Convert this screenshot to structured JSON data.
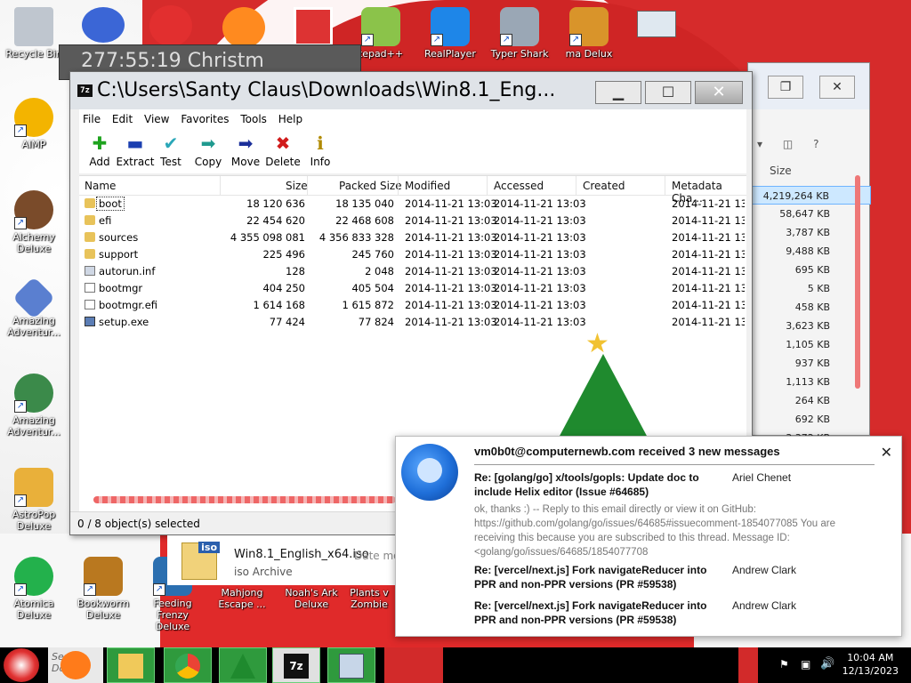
{
  "desktop": {
    "icons_left": [
      {
        "label": "Recycle Bin"
      },
      {
        "label": "AIMP"
      },
      {
        "label": "Alchemy Deluxe"
      },
      {
        "label": "Amazing Adventur..."
      },
      {
        "label": "Amazing Adventur..."
      },
      {
        "label": "AstroPop Deluxe"
      },
      {
        "label": "Atomica Deluxe"
      }
    ],
    "icons_top": [
      {
        "label": "tepad++"
      },
      {
        "label": "RealPlayer"
      },
      {
        "label": "Typer Shark"
      },
      {
        "label": "ma Delux"
      }
    ],
    "icons_bottom": [
      {
        "label": "Bookworm Deluxe"
      },
      {
        "label": "Feeding Frenzy Deluxe"
      },
      {
        "label": "Mahjong Escape ..."
      },
      {
        "label": "Noah's Ark Deluxe"
      },
      {
        "label": "Plants v Zombie"
      }
    ]
  },
  "gadget": {
    "text": "277:55:19    Christm"
  },
  "bg_window": {
    "size_header": "Size",
    "sizes": [
      "4,219,264 KB",
      "58,647 KB",
      "3,787 KB",
      "9,488 KB",
      "695 KB",
      "5 KB",
      "458 KB",
      "3,623 KB",
      "1,105 KB",
      "937 KB",
      "1,113 KB",
      "264 KB",
      "692 KB",
      "3,372 KB"
    ]
  },
  "zip": {
    "app_icon": "7z",
    "title": "C:\\Users\\Santy Claus\\Downloads\\Win8.1_Eng...",
    "menu": [
      "File",
      "Edit",
      "View",
      "Favorites",
      "Tools",
      "Help"
    ],
    "toolbar": [
      {
        "label": "Add",
        "icon": "plus-icon",
        "glyph": "✚",
        "color": "#1ea31e"
      },
      {
        "label": "Extract",
        "icon": "minus-icon",
        "glyph": "▬",
        "color": "#1b3fb0"
      },
      {
        "label": "Test",
        "icon": "check-icon",
        "glyph": "✔",
        "color": "#2aa7b8"
      },
      {
        "label": "Copy",
        "icon": "copy-arrow-icon",
        "glyph": "➡",
        "color": "#1f9a8f"
      },
      {
        "label": "Move",
        "icon": "move-arrow-icon",
        "glyph": "➡",
        "color": "#1b2f9a"
      },
      {
        "label": "Delete",
        "icon": "delete-x-icon",
        "glyph": "✖",
        "color": "#d11c1c"
      },
      {
        "label": "Info",
        "icon": "info-icon",
        "glyph": "ℹ",
        "color": "#b08a00"
      }
    ],
    "columns": [
      "Name",
      "Size",
      "Packed Size",
      "Modified",
      "Accessed",
      "Created",
      "Metadata Cha..."
    ],
    "rows": [
      {
        "name": "boot",
        "size": "18 120 636",
        "packed": "18 135 040",
        "modified": "2014-11-21 13:03",
        "accessed": "2014-11-21 13:03",
        "created": "",
        "meta": "2014-11-21 13:0",
        "kind": "folder"
      },
      {
        "name": "efi",
        "size": "22 454 620",
        "packed": "22 468 608",
        "modified": "2014-11-21 13:03",
        "accessed": "2014-11-21 13:03",
        "created": "",
        "meta": "2014-11-21 13:0",
        "kind": "folder"
      },
      {
        "name": "sources",
        "size": "4 355 098 081",
        "packed": "4 356 833 328",
        "modified": "2014-11-21 13:03",
        "accessed": "2014-11-21 13:03",
        "created": "",
        "meta": "2014-11-21 13:0",
        "kind": "folder"
      },
      {
        "name": "support",
        "size": "225 496",
        "packed": "245 760",
        "modified": "2014-11-21 13:03",
        "accessed": "2014-11-21 13:03",
        "created": "",
        "meta": "2014-11-21 13:0",
        "kind": "folder"
      },
      {
        "name": "autorun.inf",
        "size": "128",
        "packed": "2 048",
        "modified": "2014-11-21 13:03",
        "accessed": "2014-11-21 13:03",
        "created": "",
        "meta": "2014-11-21 13:0",
        "kind": "inf"
      },
      {
        "name": "bootmgr",
        "size": "404 250",
        "packed": "405 504",
        "modified": "2014-11-21 13:03",
        "accessed": "2014-11-21 13:03",
        "created": "",
        "meta": "2014-11-21 13:0",
        "kind": "file"
      },
      {
        "name": "bootmgr.efi",
        "size": "1 614 168",
        "packed": "1 615 872",
        "modified": "2014-11-21 13:03",
        "accessed": "2014-11-21 13:03",
        "created": "",
        "meta": "2014-11-21 13:0",
        "kind": "file"
      },
      {
        "name": "setup.exe",
        "size": "77 424",
        "packed": "77 824",
        "modified": "2014-11-21 13:03",
        "accessed": "2014-11-21 13:03",
        "created": "",
        "meta": "2014-11-21 13:0",
        "kind": "exe"
      }
    ],
    "status": "0 / 8 object(s) selected"
  },
  "iso_item": {
    "name": "Win8.1_English_x64.iso",
    "date_label": "Date mo",
    "type": "iso Archive",
    "tag": "iso"
  },
  "notification": {
    "header": "vm0b0t@computernewb.com received 3 new messages",
    "messages": [
      {
        "subject": "Re: [golang/go] x/tools/gopls: Update doc to include Helix editor (Issue #64685)",
        "from": "Ariel Chenet",
        "preview": "ok, thanks :) -- Reply to this email directly or view it on GitHub: https://github.com/golang/go/issues/64685#issuecomment-1854077085 You are receiving this because you are subscribed to this thread. Message ID: <golang/go/issues/64685/1854077708"
      },
      {
        "subject": "Re: [vercel/next.js] Fork navigateReducer into PPR and non-PPR versions (PR #59538)",
        "from": "Andrew Clark"
      },
      {
        "subject": "Re: [vercel/next.js] Fork navigateReducer into PPR and non-PPR versions (PR #59538)",
        "from": "Andrew Clark"
      }
    ]
  },
  "taskbar": {
    "search_text": "Search Dow",
    "time": "10:04 AM",
    "date": "12/13/2023"
  }
}
